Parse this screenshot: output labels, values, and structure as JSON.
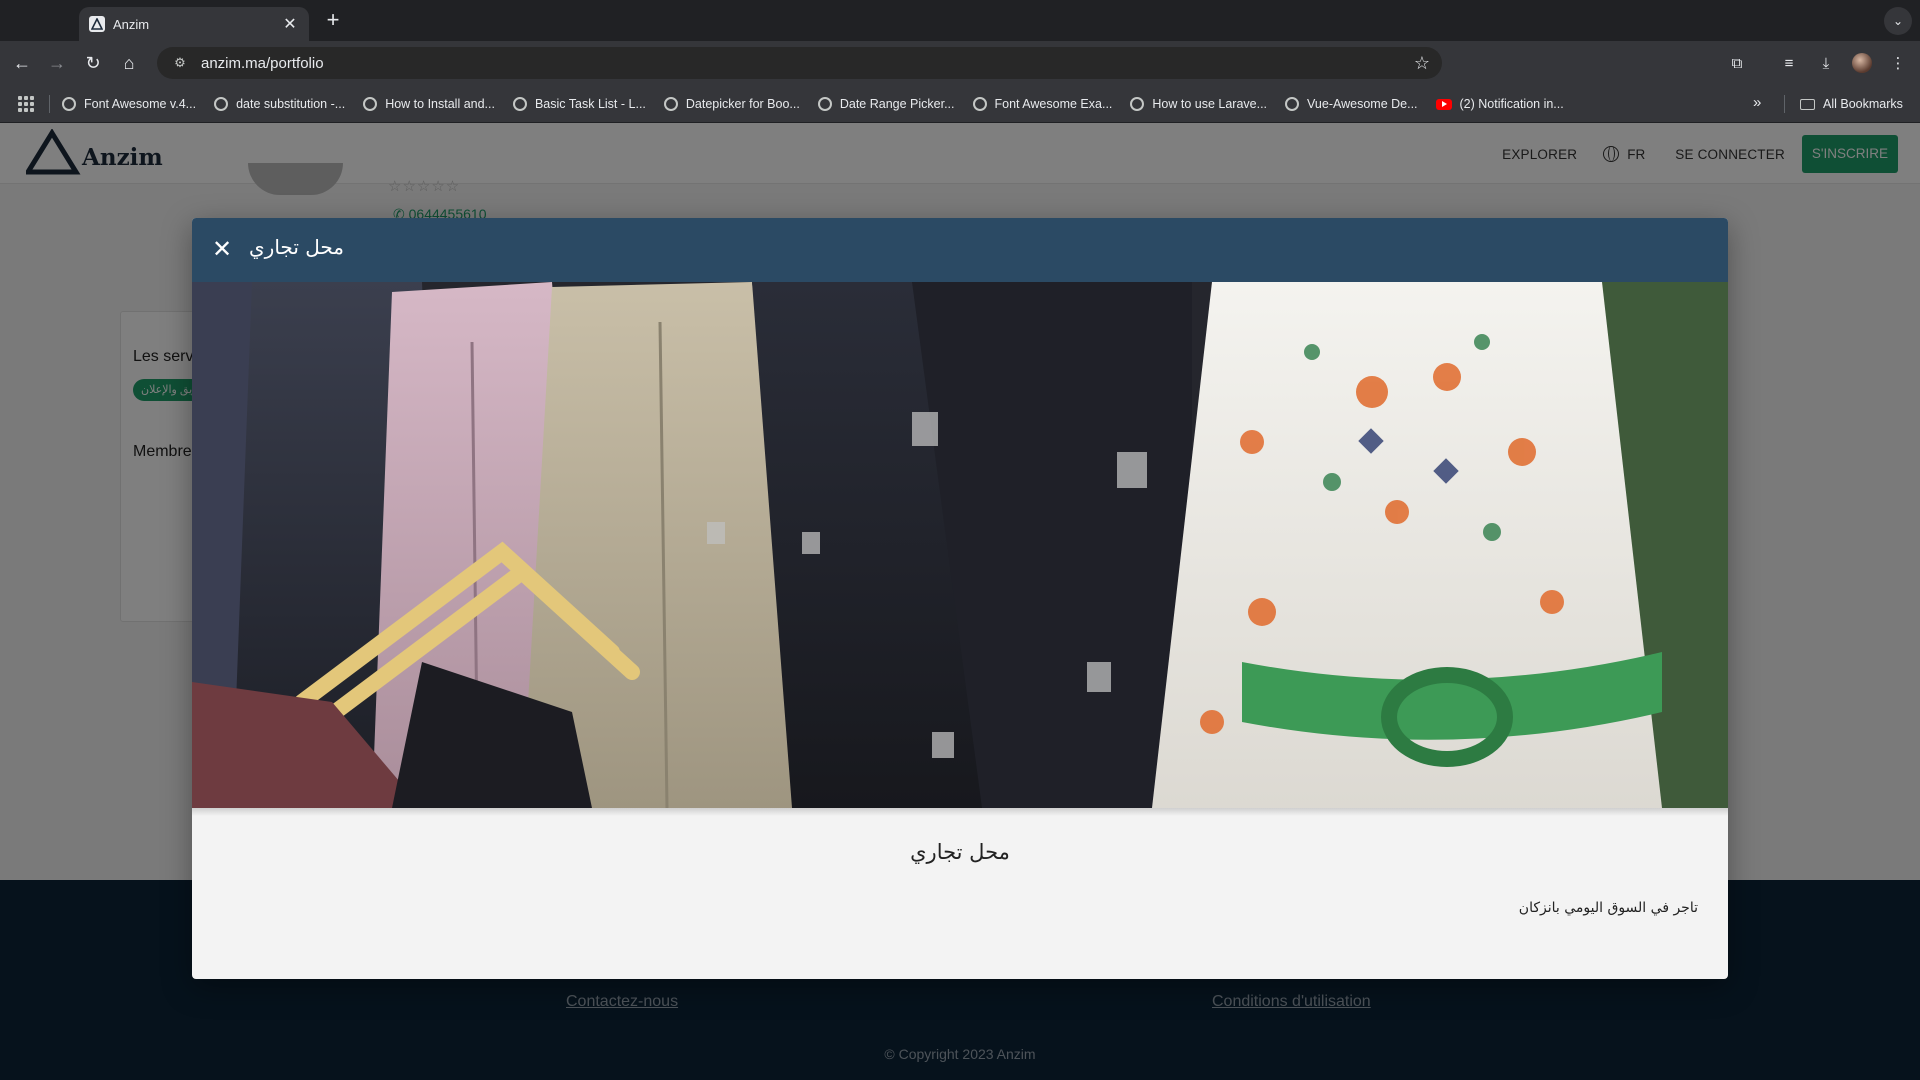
{
  "browser": {
    "tab_title": "Anzim",
    "url": "anzim.ma/portfolio",
    "bookmarks": [
      {
        "label": "Font Awesome v.4...",
        "icon": "globe-icon"
      },
      {
        "label": "date substitution -...",
        "icon": "globe-icon"
      },
      {
        "label": "How to Install and...",
        "icon": "globe-icon"
      },
      {
        "label": "Basic Task List - L...",
        "icon": "globe-icon"
      },
      {
        "label": "Datepicker for Boo...",
        "icon": "globe-icon"
      },
      {
        "label": "Date Range Picker...",
        "icon": "globe-icon"
      },
      {
        "label": "Font Awesome Exa...",
        "icon": "globe-icon"
      },
      {
        "label": "How to use Larave...",
        "icon": "globe-icon"
      },
      {
        "label": "Vue-Awesome De...",
        "icon": "globe-icon"
      },
      {
        "label": "(2) Notification in...",
        "icon": "youtube-icon"
      }
    ],
    "all_bookmarks": "All Bookmarks"
  },
  "site": {
    "logo_text": "Anzim",
    "nav": {
      "explore": "EXPLORER",
      "lang": "FR",
      "signin": "SE CONNECTER",
      "signup": "S'INSCRIRE"
    },
    "accent_color": "#1e9f6b",
    "behind": {
      "stars": "☆☆☆☆☆",
      "phone": "0644455610",
      "services_heading": "Les serv",
      "service_chip": "التسويق والإعلان",
      "members_heading": "Membre"
    },
    "footer": {
      "contact": "Contactez-nous",
      "terms": "Conditions d'utilisation",
      "copyright": "© Copyright 2023 Anzim"
    }
  },
  "modal": {
    "header_title": "محل تجاري",
    "close_icon": "close-icon",
    "header_color": "#2b4a64",
    "body_title": "محل تجاري",
    "body_text": "تاجر في السوق اليومي بانزكان"
  }
}
